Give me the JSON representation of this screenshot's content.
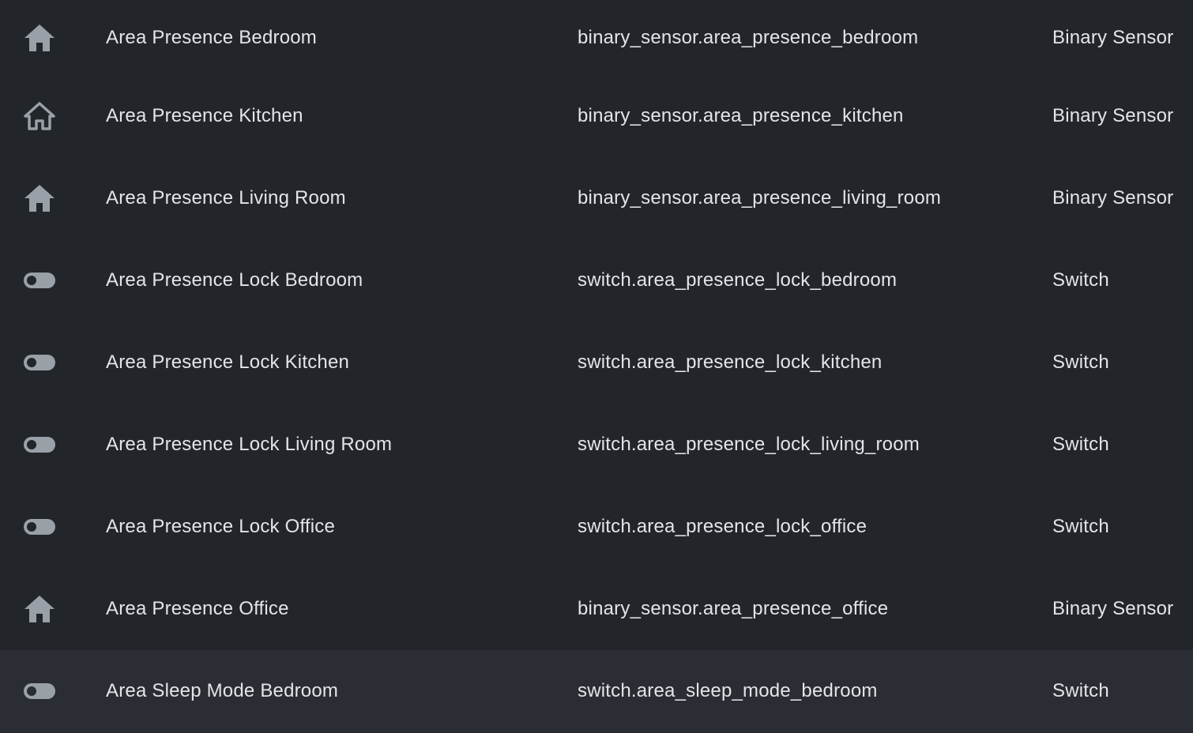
{
  "colors": {
    "background": "#22252a",
    "row_hover": "#2a2d33",
    "text": "#e3e5e8",
    "icon": "#9aa0a8"
  },
  "rows": [
    {
      "icon": "home-icon",
      "name": "Area Presence Bedroom",
      "entity_id": "binary_sensor.area_presence_bedroom",
      "domain": "Binary Sensor"
    },
    {
      "icon": "home-outline-icon",
      "name": "Area Presence Kitchen",
      "entity_id": "binary_sensor.area_presence_kitchen",
      "domain": "Binary Sensor"
    },
    {
      "icon": "home-icon",
      "name": "Area Presence Living Room",
      "entity_id": "binary_sensor.area_presence_living_room",
      "domain": "Binary Sensor"
    },
    {
      "icon": "toggle-switch-off-icon",
      "name": "Area Presence Lock Bedroom",
      "entity_id": "switch.area_presence_lock_bedroom",
      "domain": "Switch"
    },
    {
      "icon": "toggle-switch-off-icon",
      "name": "Area Presence Lock Kitchen",
      "entity_id": "switch.area_presence_lock_kitchen",
      "domain": "Switch"
    },
    {
      "icon": "toggle-switch-off-icon",
      "name": "Area Presence Lock Living Room",
      "entity_id": "switch.area_presence_lock_living_room",
      "domain": "Switch"
    },
    {
      "icon": "toggle-switch-off-icon",
      "name": "Area Presence Lock Office",
      "entity_id": "switch.area_presence_lock_office",
      "domain": "Switch"
    },
    {
      "icon": "home-icon",
      "name": "Area Presence Office",
      "entity_id": "binary_sensor.area_presence_office",
      "domain": "Binary Sensor"
    },
    {
      "icon": "toggle-switch-off-icon",
      "name": "Area Sleep Mode Bedroom",
      "entity_id": "switch.area_sleep_mode_bedroom",
      "domain": "Switch"
    }
  ]
}
